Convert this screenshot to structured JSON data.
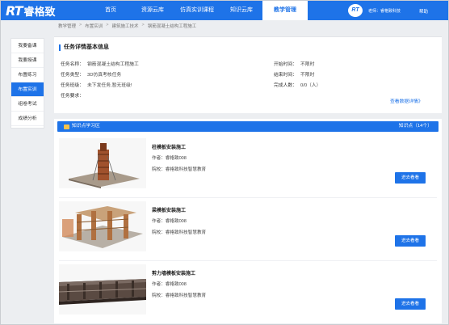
{
  "brand": {
    "logo_rt": "RT",
    "logo_name": "睿格致"
  },
  "nav": {
    "items": [
      {
        "label": "首页"
      },
      {
        "label": "资源云库"
      },
      {
        "label": "仿真实训课程"
      },
      {
        "label": "知识云库"
      },
      {
        "label": "教学管理"
      }
    ],
    "active_index": 4,
    "user_logo": "RT",
    "user_name": "老师：睿格致科技",
    "help": "帮助"
  },
  "breadcrumb": [
    "教学管理",
    "布置实训",
    "建筑施工技术",
    "钢筋混凝土结构工程施工"
  ],
  "sidebar": {
    "items": [
      {
        "label": "我要备课"
      },
      {
        "label": "我要授课"
      },
      {
        "label": "布置练习"
      },
      {
        "label": "布置实训"
      },
      {
        "label": "组卷考试"
      },
      {
        "label": "成绩分析"
      }
    ],
    "active_index": 3
  },
  "task": {
    "title": "任务详情基本信息",
    "name_label": "任务名称：",
    "name_value": "钢筋混凝土结构工程施工",
    "type_label": "任务类型：",
    "type_value": "3D仿真考核任务",
    "class_label": "任务班级：",
    "class_value": "未下发任务,暂无班级!",
    "req_label": "任务要求：",
    "start_label": "开始时间：",
    "start_value": "不限时",
    "end_label": "结束时间：",
    "end_value": "不限时",
    "done_label": "完成人数：",
    "done_value": "0/0（人）",
    "detail_link": "查看数据详情》"
  },
  "kp": {
    "title": "知识点学习区",
    "count": "知识点（14个）",
    "courses": [
      {
        "title": "柱模板安装施工",
        "author": "作者：睿格致008",
        "school": "院校：睿格致科技智慧教育",
        "button": "进去看看"
      },
      {
        "title": "梁模板安装施工",
        "author": "作者：睿格致008",
        "school": "院校：睿格致科技智慧教育",
        "button": "进去看看"
      },
      {
        "title": "剪力墙模板安装施工",
        "author": "作者：睿格致008",
        "school": "院校：睿格致科技智慧教育",
        "button": "进去看看"
      }
    ]
  }
}
